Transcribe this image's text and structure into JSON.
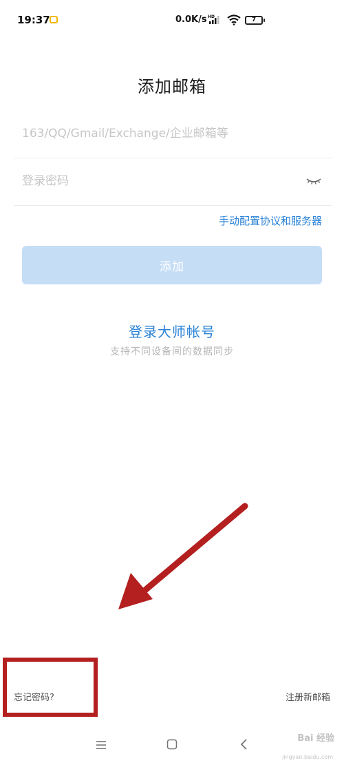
{
  "status_bar": {
    "time": "19:37",
    "speed": "0.0K/s",
    "battery": "7",
    "icons": [
      "notification-app-icon",
      "hd-signal-icon",
      "wifi-icon",
      "battery-icon"
    ]
  },
  "page": {
    "title": "添加邮箱"
  },
  "form": {
    "email_placeholder": "163/QQ/Gmail/Exchange/企业邮箱等",
    "email_value": "",
    "password_placeholder": "登录密码",
    "password_value": "",
    "manual_config_label": "手动配置协议和服务器",
    "add_button_label": "添加"
  },
  "master_account": {
    "login_label": "登录大师帐号",
    "subtitle": "支持不同设备间的数据同步"
  },
  "footer": {
    "forgot_password": "忘记密码?",
    "register": "注册新邮箱"
  },
  "watermark": {
    "text": "Bai 经验",
    "sub": "jingyan.baidu.com"
  },
  "colors": {
    "accent": "#2a82d6",
    "button_disabled": "#c6ddf6",
    "annotation": "#b41f1f"
  }
}
